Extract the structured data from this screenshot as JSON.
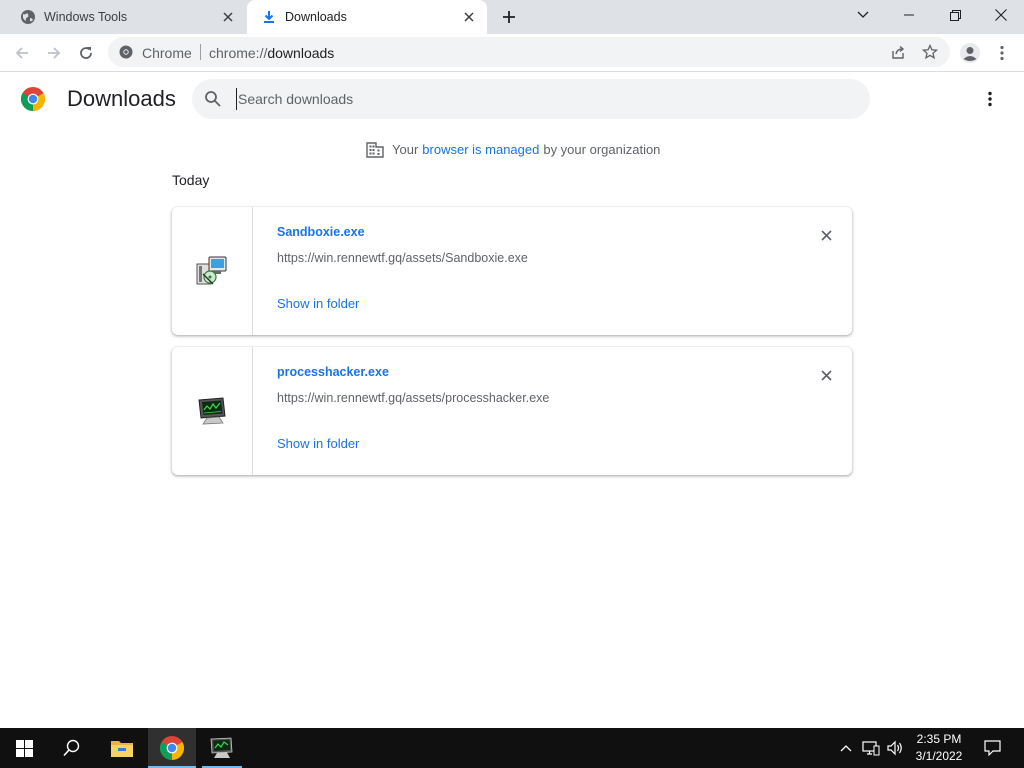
{
  "tabs": [
    {
      "title": "Windows Tools",
      "icon": "globe-icon",
      "active": false
    },
    {
      "title": "Downloads",
      "icon": "download-icon",
      "active": true
    }
  ],
  "omnibox": {
    "site_label": "Chrome",
    "url_scheme": "chrome://",
    "url_path": "downloads"
  },
  "downloads_page": {
    "title": "Downloads",
    "search_placeholder": "Search downloads",
    "managed_notice": {
      "prefix": "Your",
      "link": "browser is managed",
      "suffix": "by your organization"
    },
    "date_header": "Today",
    "items": [
      {
        "file_name": "Sandboxie.exe",
        "url": "https://win.rennewtf.gq/assets/Sandboxie.exe",
        "action": "Show in folder",
        "icon": "installer-icon"
      },
      {
        "file_name": "processhacker.exe",
        "url": "https://win.rennewtf.gq/assets/processhacker.exe",
        "action": "Show in folder",
        "icon": "monitor-app-icon"
      }
    ]
  },
  "taskbar": {
    "time": "2:35 PM",
    "date": "3/1/2022",
    "items": [
      "start-icon",
      "search-icon",
      "file-explorer-icon",
      "chrome-icon",
      "process-hacker-icon"
    ]
  },
  "colors": {
    "accent": "#1a73e8",
    "tabstrip": "#dee1e6",
    "taskbar": "#101010"
  }
}
